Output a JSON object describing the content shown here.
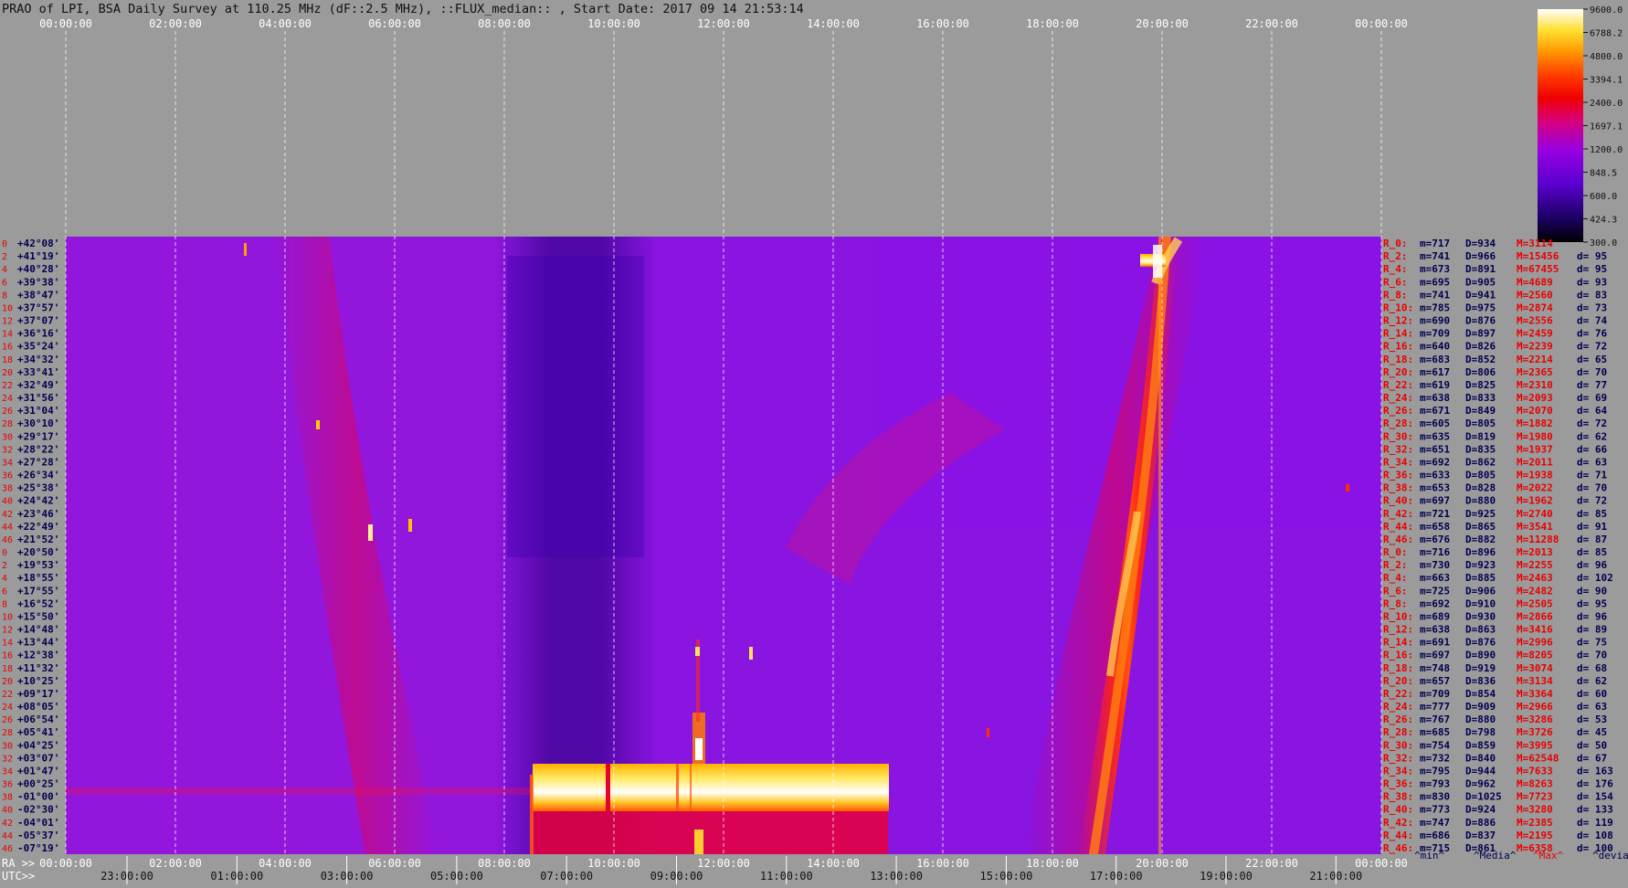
{
  "chart_data": {
    "type": "heatmap",
    "title": "PRAO of LPI, BSA Daily Survey at 110.25 MHz (dF::2.5 MHz), ::FLUX_median:: , Start Date: 2017 09 14 21:53:14",
    "top_axis_ticks": [
      "00:00:00",
      "02:00:00",
      "04:00:00",
      "06:00:00",
      "08:00:00",
      "10:00:00",
      "12:00:00",
      "14:00:00",
      "16:00:00",
      "18:00:00",
      "20:00:00",
      "22:00:00",
      "00:00:00"
    ],
    "ra_axis_label": "RA >>",
    "ra_ticks": [
      "00:00:00",
      "02:00:00",
      "04:00:00",
      "06:00:00",
      "08:00:00",
      "10:00:00",
      "12:00:00",
      "14:00:00",
      "16:00:00",
      "18:00:00",
      "20:00:00",
      "22:00:00",
      "00:00:00"
    ],
    "utc_axis_label": "UTC>>",
    "utc_ticks": [
      "23:00:00",
      "01:00:00",
      "03:00:00",
      "05:00:00",
      "07:00:00",
      "09:00:00",
      "11:00:00",
      "13:00:00",
      "15:00:00",
      "17:00:00",
      "19:00:00",
      "21:00:00"
    ],
    "colorbar": {
      "ticks": [
        "9600.0",
        "6788.2",
        "4800.0",
        "3394.1",
        "2400.0",
        "1697.1",
        "1200.0",
        "848.5",
        "600.0",
        "424.3",
        "300.0"
      ],
      "range": [
        300.0,
        9600.0
      ],
      "scale": "log"
    },
    "row_index_labels": [
      "0",
      "2",
      "4",
      "6",
      "8",
      "10",
      "12",
      "14",
      "16",
      "18",
      "20",
      "22",
      "24",
      "26",
      "28",
      "30",
      "32",
      "34",
      "36",
      "38",
      "40",
      "42",
      "44",
      "46",
      "0",
      "2",
      "4",
      "6",
      "8",
      "10",
      "12",
      "14",
      "16",
      "18",
      "20",
      "22",
      "24",
      "26",
      "28",
      "30",
      "32",
      "34",
      "36",
      "38",
      "40",
      "42",
      "44",
      "46"
    ],
    "declinations": [
      "+42°08'",
      "+41°19'",
      "+40°28'",
      "+39°38'",
      "+38°47'",
      "+37°57'",
      "+37°07'",
      "+36°16'",
      "+35°24'",
      "+34°32'",
      "+33°41'",
      "+32°49'",
      "+31°56'",
      "+31°04'",
      "+30°10'",
      "+29°17'",
      "+28°22'",
      "+27°28'",
      "+26°34'",
      "+25°38'",
      "+24°42'",
      "+23°46'",
      "+22°49'",
      "+21°52'",
      "+20°50'",
      "+19°53'",
      "+18°55'",
      "+17°55'",
      "+16°52'",
      "+15°50'",
      "+14°48'",
      "+13°44'",
      "+12°38'",
      "+11°32'",
      "+10°25'",
      "+09°17'",
      "+08°05'",
      "+06°54'",
      "+05°41'",
      "+04°25'",
      "+03°07'",
      "+01°47'",
      "+00°25'",
      "-01°00'",
      "-02°30'",
      "-04°01'",
      "-05°37'",
      "-07°19'"
    ],
    "row_stats": [
      {
        "r": "R_0:",
        "m": "m=717",
        "D": "D=934",
        "M": "M=3114",
        "d": ""
      },
      {
        "r": "R_2:",
        "m": "m=741",
        "D": "D=966",
        "M": "M=15456",
        "d": "d= 95"
      },
      {
        "r": "R_4:",
        "m": "m=673",
        "D": "D=891",
        "M": "M=67455",
        "d": "d= 95"
      },
      {
        "r": "R_6:",
        "m": "m=695",
        "D": "D=905",
        "M": "M=4689",
        "d": "d= 93"
      },
      {
        "r": "R_8:",
        "m": "m=741",
        "D": "D=941",
        "M": "M=2560",
        "d": "d= 83"
      },
      {
        "r": "R_10:",
        "m": "m=785",
        "D": "D=975",
        "M": "M=2874",
        "d": "d= 73"
      },
      {
        "r": "R_12:",
        "m": "m=690",
        "D": "D=876",
        "M": "M=2556",
        "d": "d= 74"
      },
      {
        "r": "R_14:",
        "m": "m=709",
        "D": "D=897",
        "M": "M=2459",
        "d": "d= 76"
      },
      {
        "r": "R_16:",
        "m": "m=640",
        "D": "D=826",
        "M": "M=2239",
        "d": "d= 72"
      },
      {
        "r": "R_18:",
        "m": "m=683",
        "D": "D=852",
        "M": "M=2214",
        "d": "d= 65"
      },
      {
        "r": "R_20:",
        "m": "m=617",
        "D": "D=806",
        "M": "M=2365",
        "d": "d= 70"
      },
      {
        "r": "R_22:",
        "m": "m=619",
        "D": "D=825",
        "M": "M=2310",
        "d": "d= 77"
      },
      {
        "r": "R_24:",
        "m": "m=638",
        "D": "D=833",
        "M": "M=2093",
        "d": "d= 69"
      },
      {
        "r": "R_26:",
        "m": "m=671",
        "D": "D=849",
        "M": "M=2070",
        "d": "d= 64"
      },
      {
        "r": "R_28:",
        "m": "m=605",
        "D": "D=805",
        "M": "M=1882",
        "d": "d= 72"
      },
      {
        "r": "R_30:",
        "m": "m=635",
        "D": "D=819",
        "M": "M=1980",
        "d": "d= 62"
      },
      {
        "r": "R_32:",
        "m": "m=651",
        "D": "D=835",
        "M": "M=1937",
        "d": "d= 66"
      },
      {
        "r": "R_34:",
        "m": "m=692",
        "D": "D=862",
        "M": "M=2011",
        "d": "d= 63"
      },
      {
        "r": "R_36:",
        "m": "m=633",
        "D": "D=805",
        "M": "M=1938",
        "d": "d= 71"
      },
      {
        "r": "R_38:",
        "m": "m=653",
        "D": "D=828",
        "M": "M=2022",
        "d": "d= 70"
      },
      {
        "r": "R_40:",
        "m": "m=697",
        "D": "D=880",
        "M": "M=1962",
        "d": "d= 72"
      },
      {
        "r": "R_42:",
        "m": "m=721",
        "D": "D=925",
        "M": "M=2740",
        "d": "d= 85"
      },
      {
        "r": "R_44:",
        "m": "m=658",
        "D": "D=865",
        "M": "M=3541",
        "d": "d= 91"
      },
      {
        "r": "R_46:",
        "m": "m=676",
        "D": "D=882",
        "M": "M=11288",
        "d": "d= 87"
      },
      {
        "r": "R_0:",
        "m": "m=716",
        "D": "D=896",
        "M": "M=2013",
        "d": "d= 85"
      },
      {
        "r": "R_2:",
        "m": "m=730",
        "D": "D=923",
        "M": "M=2255",
        "d": "d= 96"
      },
      {
        "r": "R_4:",
        "m": "m=663",
        "D": "D=885",
        "M": "M=2463",
        "d": "d= 102"
      },
      {
        "r": "R_6:",
        "m": "m=725",
        "D": "D=906",
        "M": "M=2482",
        "d": "d= 90"
      },
      {
        "r": "R_8:",
        "m": "m=692",
        "D": "D=910",
        "M": "M=2505",
        "d": "d= 95"
      },
      {
        "r": "R_10:",
        "m": "m=689",
        "D": "D=930",
        "M": "M=2866",
        "d": "d= 96"
      },
      {
        "r": "R_12:",
        "m": "m=638",
        "D": "D=863",
        "M": "M=3416",
        "d": "d= 89"
      },
      {
        "r": "R_14:",
        "m": "m=691",
        "D": "D=876",
        "M": "M=2996",
        "d": "d= 75"
      },
      {
        "r": "R_16:",
        "m": "m=697",
        "D": "D=890",
        "M": "M=8205",
        "d": "d= 70"
      },
      {
        "r": "R_18:",
        "m": "m=748",
        "D": "D=919",
        "M": "M=3074",
        "d": "d= 68"
      },
      {
        "r": "R_20:",
        "m": "m=657",
        "D": "D=836",
        "M": "M=3134",
        "d": "d= 62"
      },
      {
        "r": "R_22:",
        "m": "m=709",
        "D": "D=854",
        "M": "M=3364",
        "d": "d= 60"
      },
      {
        "r": "R_24:",
        "m": "m=777",
        "D": "D=909",
        "M": "M=2966",
        "d": "d= 63"
      },
      {
        "r": "R_26:",
        "m": "m=767",
        "D": "D=880",
        "M": "M=3286",
        "d": "d= 53"
      },
      {
        "r": "R_28:",
        "m": "m=685",
        "D": "D=798",
        "M": "M=3726",
        "d": "d= 45"
      },
      {
        "r": "R_30:",
        "m": "m=754",
        "D": "D=859",
        "M": "M=3995",
        "d": "d= 50"
      },
      {
        "r": "R_32:",
        "m": "m=732",
        "D": "D=840",
        "M": "M=62548",
        "d": "d= 67"
      },
      {
        "r": "R_34:",
        "m": "m=795",
        "D": "D=944",
        "M": "M=7633",
        "d": "d= 163"
      },
      {
        "r": "R_36:",
        "m": "m=793",
        "D": "D=962",
        "M": "M=8263",
        "d": "d= 176"
      },
      {
        "r": "R_38:",
        "m": "m=830",
        "D": "D=1025",
        "M": "M=7723",
        "d": "d= 154"
      },
      {
        "r": "R_40:",
        "m": "m=773",
        "D": "D=924",
        "M": "M=3280",
        "d": "d= 133"
      },
      {
        "r": "R_42:",
        "m": "m=747",
        "D": "D=886",
        "M": "M=2385",
        "d": "d= 119"
      },
      {
        "r": "R_44:",
        "m": "m=686",
        "D": "D=837",
        "M": "M=2195",
        "d": "d= 108"
      },
      {
        "r": "R_46:",
        "m": "m=715",
        "D": "D=861",
        "M": "M=6358",
        "d": "d= 100"
      }
    ],
    "stats_legend": [
      "^min^",
      "^Media^",
      "^Max^",
      "^devia^"
    ]
  },
  "colors": {
    "background": "#9b9b9b",
    "label_dark": "#000050",
    "label_red": "#e80000",
    "axis_text": "#ffffff",
    "axis_dark": "#111111"
  }
}
